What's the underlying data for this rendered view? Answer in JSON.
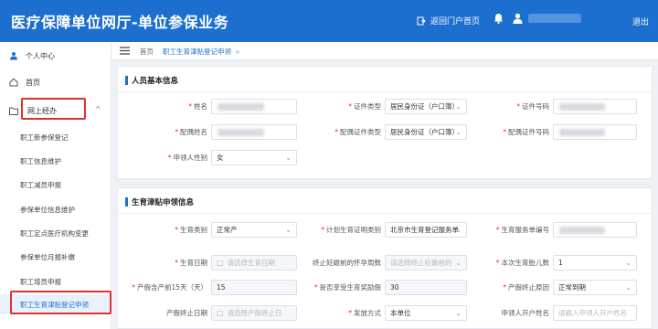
{
  "header": {
    "title": "医疗保障单位网厅-单位参保业务",
    "portal_link": "返回门户首页",
    "logout": "退出"
  },
  "sidebar": {
    "personal_center": "个人中心",
    "home": "首页",
    "online_agent": "网上经办",
    "items": [
      "职工新参保登记",
      "职工信息维护",
      "职工减员申报",
      "参保单位信息维护",
      "职工定点医疗机构变更",
      "参保单位月报补缴",
      "职工增员申报",
      "职工生育津贴登记申领"
    ]
  },
  "tabs": {
    "home": "首页",
    "active": "职工生育津贴登记申领",
    "close": "×"
  },
  "section1": {
    "title": "人员基本信息",
    "name_label": "姓名",
    "id_type_label": "证件类型",
    "id_type_value": "居民身份证（户口簿）",
    "id_no_label": "证件号码",
    "spouse_name_label": "配偶姓名",
    "spouse_id_type_label": "配偶证件类型",
    "spouse_id_type_value": "居民身份证（户口簿）",
    "spouse_id_no_label": "配偶证件号码",
    "gender_label": "申领人性别",
    "gender_value": "女"
  },
  "section2": {
    "title": "生育津贴申领信息",
    "birth_type_label": "生育类别",
    "birth_type_value": "正常产",
    "plan_cert_label": "计划生育证明类别",
    "plan_cert_value": "北京市生育登记服务单",
    "service_no_label": "生育服务单编号",
    "birth_date_label": "生育日期",
    "birth_date_placeholder": "请选择生育日期",
    "pregnancy_label": "终止妊娠前的怀孕周数",
    "pregnancy_placeholder": "请选择终止妊娠前的",
    "births_count_label": "本次生育胎儿数",
    "births_count_value": "1",
    "prenatal_label": "产假含产前15天（天）",
    "prenatal_value": "15",
    "award_label": "是否享受生育奖励假",
    "award_value": "30",
    "leave_reason_label": "产假终止原因",
    "leave_reason_value": "正常到期",
    "leave_end_label": "产假终止日期",
    "leave_end_placeholder": "请选择产假终止日",
    "pay_method_label": "发放方式",
    "pay_method_value": "本单位",
    "account_name_label": "申领人开户姓名",
    "account_name_placeholder": "请输入申领人开户姓名"
  },
  "colors": {
    "brand": "#1d6fcf",
    "highlight_box": "#e0322c"
  }
}
